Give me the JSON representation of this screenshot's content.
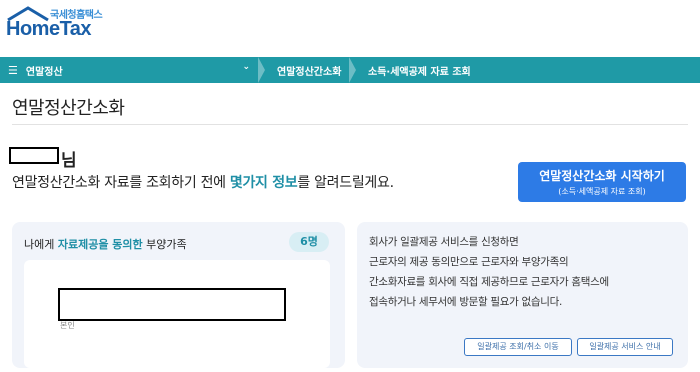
{
  "logo": {
    "small_text": "국세청홈택스",
    "big_text": "HomeTax",
    "brand_color": "#1a5fa8"
  },
  "navbar": {
    "menu_icon": "hamburger-icon",
    "menu_label": "연말정산",
    "menu_chevron": "chevron-down-icon",
    "crumb1": "연말정산간소화",
    "crumb2": "소득·세액공제 자료 조회",
    "bg_color": "#1f9aa6"
  },
  "page": {
    "title": "연말정산간소화"
  },
  "greeting": {
    "honorific": "님",
    "intro_prefix": "연말정산간소화 자료를 조회하기 전에 ",
    "intro_highlight": "몇가지 정보",
    "intro_suffix": "를 알려드릴게요."
  },
  "start_button": {
    "label": "연말정산간소화 시작하기",
    "sublabel": "(소득·세액공제 자료 조회)",
    "color": "#2d7be6"
  },
  "dependents_card": {
    "heading_prefix": "나에게 ",
    "heading_highlight": "자료제공을 동의한",
    "heading_suffix": " 부양가족",
    "count": "6명",
    "item_label": "본인"
  },
  "info_card": {
    "lines": [
      "회사가 일괄제공 서비스를 신청하면",
      "근로자의 제공 동의만으로 근로자와 부양가족의",
      "간소화자료를 회사에 직접 제공하므로 근로자가 홈택스에",
      "접속하거나 세무서에 방문할 필요가 없습니다."
    ],
    "button1": "일괄제공 조회/취소 이동",
    "button2": "일괄제공 서비스 안내"
  }
}
